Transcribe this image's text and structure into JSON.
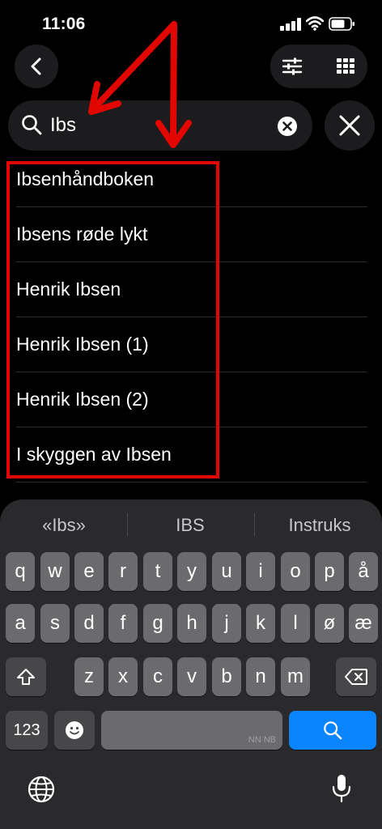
{
  "status": {
    "time": "11:06"
  },
  "search": {
    "query": "Ibs"
  },
  "results": [
    "Ibsenhåndboken",
    "Ibsens røde lykt",
    "Henrik Ibsen",
    "Henrik Ibsen (1)",
    "Henrik Ibsen (2)",
    "I skyggen av Ibsen"
  ],
  "keyboard": {
    "suggestions": [
      "«Ibs»",
      "IBS",
      "Instruks"
    ],
    "row1": [
      "q",
      "w",
      "e",
      "r",
      "t",
      "y",
      "u",
      "i",
      "o",
      "p",
      "å"
    ],
    "row2": [
      "a",
      "s",
      "d",
      "f",
      "g",
      "h",
      "j",
      "k",
      "l",
      "ø",
      "æ"
    ],
    "row3": [
      "z",
      "x",
      "c",
      "v",
      "b",
      "n",
      "m"
    ],
    "numbers_key": "123",
    "space_hint": "NN NB"
  },
  "colors": {
    "highlight": "#e10600",
    "search_key": "#0a84ff"
  }
}
